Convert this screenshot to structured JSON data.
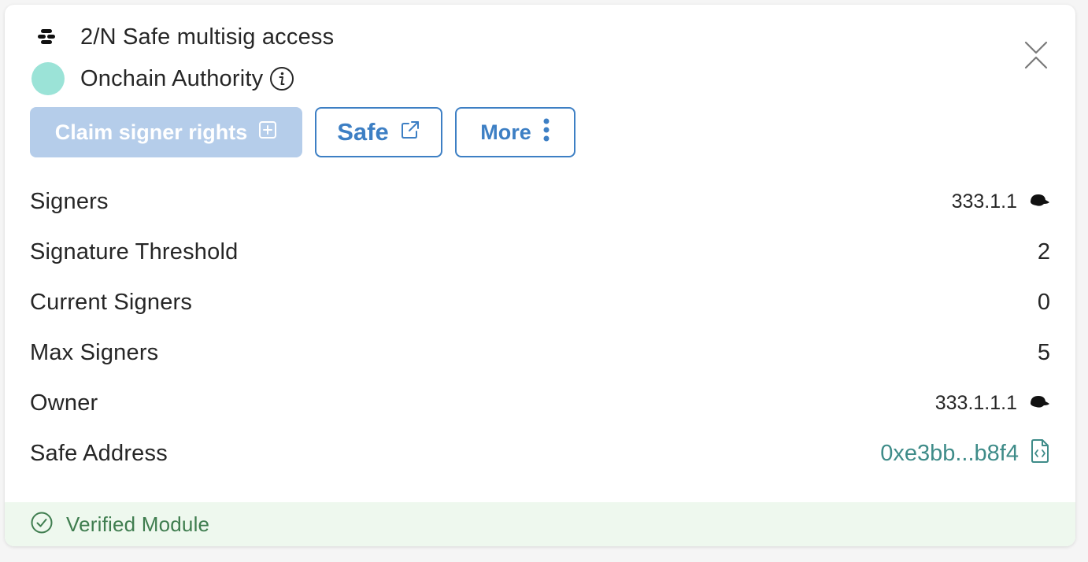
{
  "module": {
    "title": "2/N Safe multisig access",
    "subtitle": "Onchain Authority",
    "icon": "module-icon",
    "dot_color": "#9be3d7"
  },
  "actions": {
    "claim_label": "Claim signer rights",
    "safe_label": "Safe",
    "more_label": "More"
  },
  "details": {
    "signers": {
      "label": "Signers",
      "value": "333.1.1"
    },
    "threshold": {
      "label": "Signature Threshold",
      "value": "2"
    },
    "current": {
      "label": "Current Signers",
      "value": "0"
    },
    "max": {
      "label": "Max Signers",
      "value": "5"
    },
    "owner": {
      "label": "Owner",
      "value": "333.1.1.1"
    },
    "address": {
      "label": "Safe Address",
      "value": "0xe3bb...b8f4"
    }
  },
  "footer": {
    "label": "Verified Module"
  },
  "colors": {
    "accent": "#3d7fc4",
    "claim_disabled": "#b5cdea",
    "address": "#3f8c89",
    "verified": "#3f7d4f",
    "footer_bg": "#eef8ee"
  }
}
